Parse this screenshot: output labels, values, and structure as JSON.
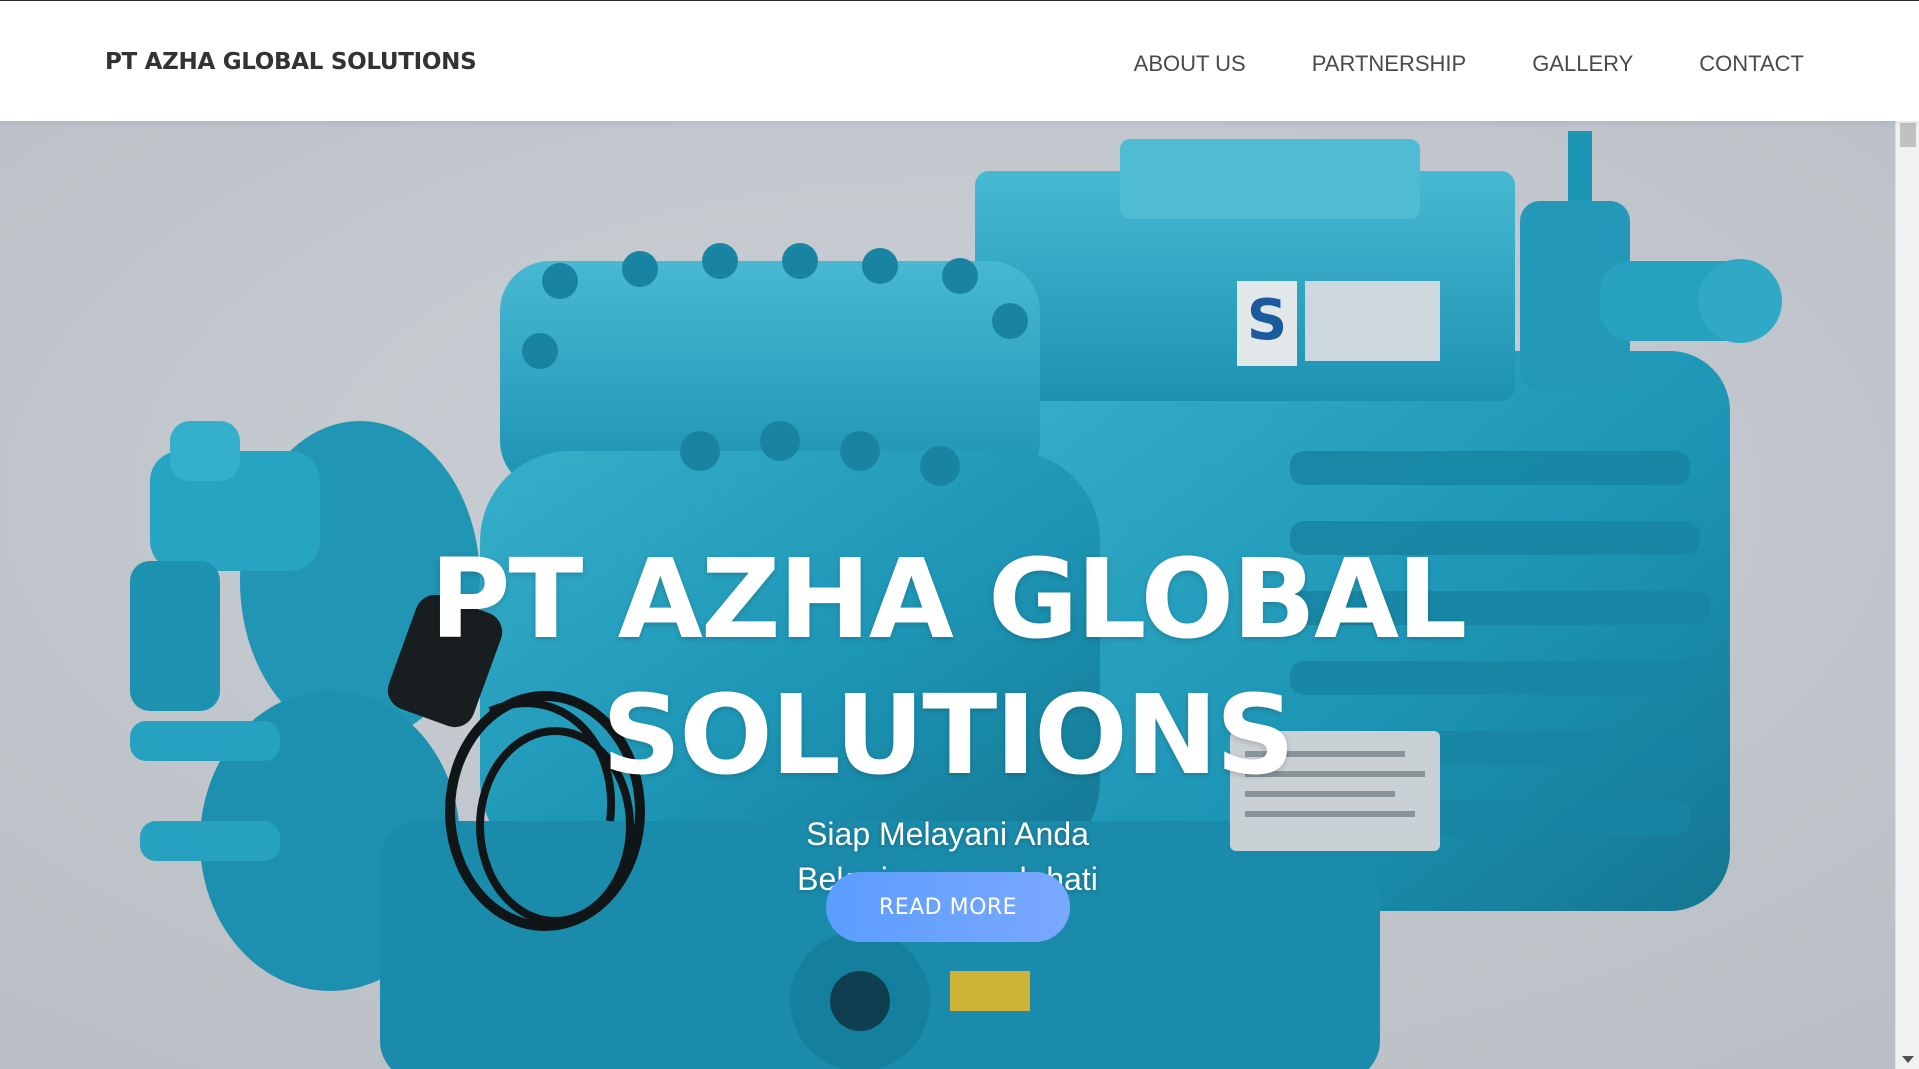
{
  "brand": {
    "name": "PT AZHA GLOBAL SOLUTIONS"
  },
  "nav": {
    "items": [
      {
        "label": "ABOUT US"
      },
      {
        "label": "PARTNERSHIP"
      },
      {
        "label": "GALLERY"
      },
      {
        "label": "CONTACT"
      }
    ]
  },
  "hero": {
    "title_line1": "PT AZHA GLOBAL",
    "title_line2": "SOLUTIONS",
    "subtitle_line1": "Siap Melayani Anda",
    "subtitle_line2": "Bekerja sepenuh hati",
    "button_label": "READ MORE",
    "image_name": "compressor-photo"
  },
  "colors": {
    "brand_text": "#333333",
    "nav_text": "#4a4a4a",
    "compressor": "#27a6c6",
    "button": "#5b9dff"
  }
}
